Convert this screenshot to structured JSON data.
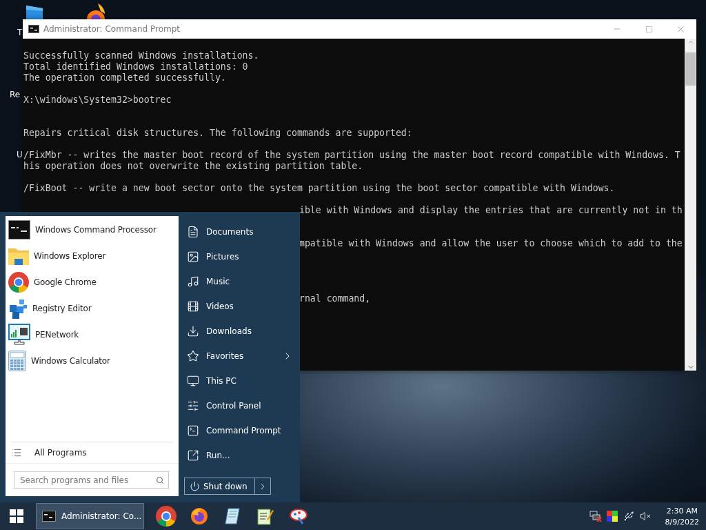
{
  "desktop": {
    "icons": [
      {
        "kind": "folder",
        "label": "T"
      },
      {
        "kind": "firefox"
      }
    ],
    "labels": [
      {
        "text": "Re",
        "kind": "middle"
      },
      {
        "text": "U",
        "kind": "low"
      }
    ]
  },
  "console_window": {
    "title": "Administrator: Command Prompt",
    "lines": [
      {
        "kind": "full",
        "text": "Successfully scanned Windows installations."
      },
      {
        "kind": "full",
        "text": "Total identified Windows installations: 0"
      },
      {
        "kind": "full",
        "text": "The operation completed successfully."
      },
      {
        "kind": "blank"
      },
      {
        "kind": "full",
        "text": "X:\\windows\\System32>bootrec"
      },
      {
        "kind": "blank"
      },
      {
        "kind": "blank"
      },
      {
        "kind": "full",
        "text": "Repairs critical disk structures. The following commands are supported:"
      },
      {
        "kind": "blank"
      },
      {
        "kind": "full",
        "text": "/FixMbr -- writes the master boot record of the system partition using the master boot record compatible with Windows. T"
      },
      {
        "kind": "full",
        "text": "his operation does not overwrite the existing partition table."
      },
      {
        "kind": "blank"
      },
      {
        "kind": "full",
        "text": "/FixBoot -- write a new boot sector onto the system partition using the boot sector compatible with Windows."
      },
      {
        "kind": "blank"
      },
      {
        "kind": "partial",
        "text": "ible with Windows and display the entries that are currently not in th"
      },
      {
        "kind": "blank"
      },
      {
        "kind": "blank"
      },
      {
        "kind": "partial",
        "text": "mpatible with Windows and allow the user to choose which to add to the"
      },
      {
        "kind": "blank"
      },
      {
        "kind": "blank"
      },
      {
        "kind": "blank"
      },
      {
        "kind": "blank"
      },
      {
        "kind": "partial",
        "text": "rnal command,"
      }
    ]
  },
  "start_menu": {
    "programs": [
      {
        "label": "Windows Command Processor",
        "kind": "console"
      },
      {
        "label": "Windows Explorer",
        "kind": "folder"
      },
      {
        "label": "Google Chrome",
        "kind": "chrome"
      },
      {
        "label": "Registry Editor",
        "kind": "registry"
      },
      {
        "label": "PENetwork",
        "kind": "network"
      },
      {
        "label": "Windows Calculator",
        "kind": "calculator"
      }
    ],
    "all_programs": "All Programs",
    "search": {
      "placeholder": "Search programs and files"
    },
    "places": [
      {
        "label": "Documents",
        "kind": "document",
        "has_submenu": false
      },
      {
        "label": "Pictures",
        "kind": "picture",
        "has_submenu": false
      },
      {
        "label": "Music",
        "kind": "music",
        "has_submenu": false
      },
      {
        "label": "Videos",
        "kind": "video",
        "has_submenu": false
      },
      {
        "label": "Downloads",
        "kind": "download",
        "has_submenu": false
      },
      {
        "label": "Favorites",
        "kind": "star",
        "has_submenu": true
      },
      {
        "label": "This PC",
        "kind": "monitor",
        "has_submenu": false
      },
      {
        "label": "Control Panel",
        "kind": "sliders",
        "has_submenu": false
      },
      {
        "label": "Command Prompt",
        "kind": "terminal",
        "has_submenu": false
      },
      {
        "label": "Run...",
        "kind": "run",
        "has_submenu": false
      }
    ],
    "shutdown": "Shut down"
  },
  "taskbar": {
    "tasks": [
      {
        "label": "Administrator: Co...",
        "selected": true
      }
    ],
    "pinned": [
      {
        "kind": "chrome"
      },
      {
        "kind": "firefox"
      },
      {
        "kind": "notepad"
      },
      {
        "kind": "editor"
      },
      {
        "kind": "paint"
      }
    ],
    "clock": {
      "time": "2:30 AM",
      "date": "8/9/2022"
    }
  }
}
